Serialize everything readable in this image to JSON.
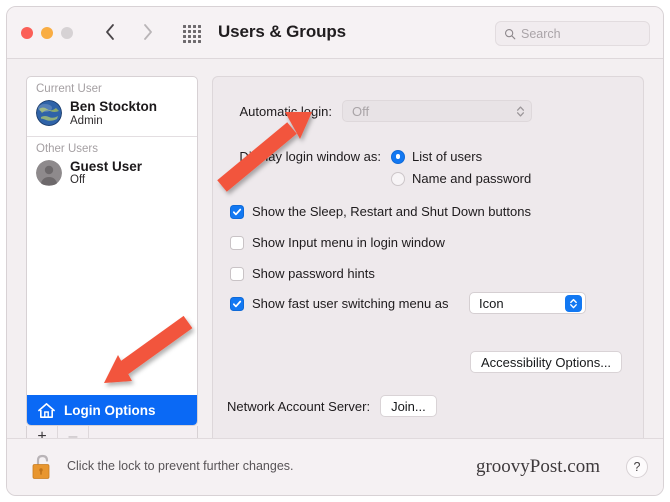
{
  "window": {
    "title": "Users & Groups",
    "traffic_lights": [
      "close-button",
      "minimize-button",
      "zoom-button"
    ],
    "nav": {
      "back_icon": "chevron-left-icon",
      "forward_icon": "chevron-right-icon"
    },
    "grid_icon": "app-grid-icon"
  },
  "search": {
    "placeholder": "Search",
    "value": "",
    "icon": "search-icon"
  },
  "sidebar": {
    "groups": [
      {
        "header": "Current User",
        "users": [
          {
            "name": "Ben Stockton",
            "subtitle": "Admin",
            "avatar": "globe-avatar"
          }
        ]
      },
      {
        "header": "Other Users",
        "users": [
          {
            "name": "Guest User",
            "subtitle": "Off",
            "avatar": "person-avatar"
          }
        ]
      }
    ],
    "login_options": {
      "label": "Login Options",
      "icon": "house-icon",
      "selected": true
    },
    "toolbar": {
      "add_label": "+",
      "remove_label": "–",
      "add_enabled": true,
      "remove_enabled": false
    }
  },
  "main": {
    "automatic_login": {
      "label": "Automatic login:",
      "value": "Off",
      "enabled": false,
      "chevron_icon": "chevron-up-down-icon"
    },
    "display_login_window": {
      "label": "Display login window as:",
      "options": [
        {
          "label": "List of users",
          "selected": true
        },
        {
          "label": "Name and password",
          "selected": false
        }
      ]
    },
    "checkboxes": [
      {
        "label": "Show the Sleep, Restart and Shut Down buttons",
        "checked": true
      },
      {
        "label": "Show Input menu in login window",
        "checked": false
      },
      {
        "label": "Show password hints",
        "checked": false
      },
      {
        "label": "Show fast user switching menu as",
        "checked": true
      }
    ],
    "fast_user_switching": {
      "value": "Icon",
      "enabled": true,
      "chevron_icon": "chevron-up-down-icon"
    },
    "accessibility_button": "Accessibility Options...",
    "network_account_server": {
      "label": "Network Account Server:",
      "button": "Join..."
    }
  },
  "footer": {
    "lock_icon": "unlocked-padlock-icon",
    "lock_text": "Click the lock to prevent further changes.",
    "watermark": "groovyPost.com",
    "help_label": "?"
  },
  "annotations": {
    "arrow_color": "#f2553d",
    "arrows": [
      {
        "name": "arrow-to-automatic-login",
        "points_to": "automatic-login-popup"
      },
      {
        "name": "arrow-to-login-options",
        "points_to": "sidebar-login-options"
      }
    ]
  },
  "colors": {
    "accent": "#1278f2",
    "selection": "#0a69f5",
    "window_bg": "#f3eff1",
    "panel_bg": "#eee9ec"
  }
}
